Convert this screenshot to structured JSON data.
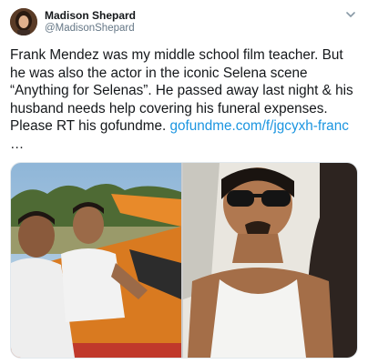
{
  "tweet": {
    "author_name": "Madison Shepard",
    "author_handle": "@MadisonShepard",
    "caret_icon": "chevron-down-icon",
    "text_lines": [
      "Frank Mendez was my middle school film teacher. But",
      "he was also the actor in the iconic Selena scene",
      "“Anything for Selenas”. He passed away last night & his",
      "husband needs help covering his funeral expenses.",
      "Please RT his gofundme. "
    ],
    "link_text": "gofundme.com/f/jgcyxh-franc",
    "ellipsis": "…"
  },
  "colors": {
    "text": "#14171a",
    "secondary_text": "#657786",
    "link": "#1b95e0"
  }
}
